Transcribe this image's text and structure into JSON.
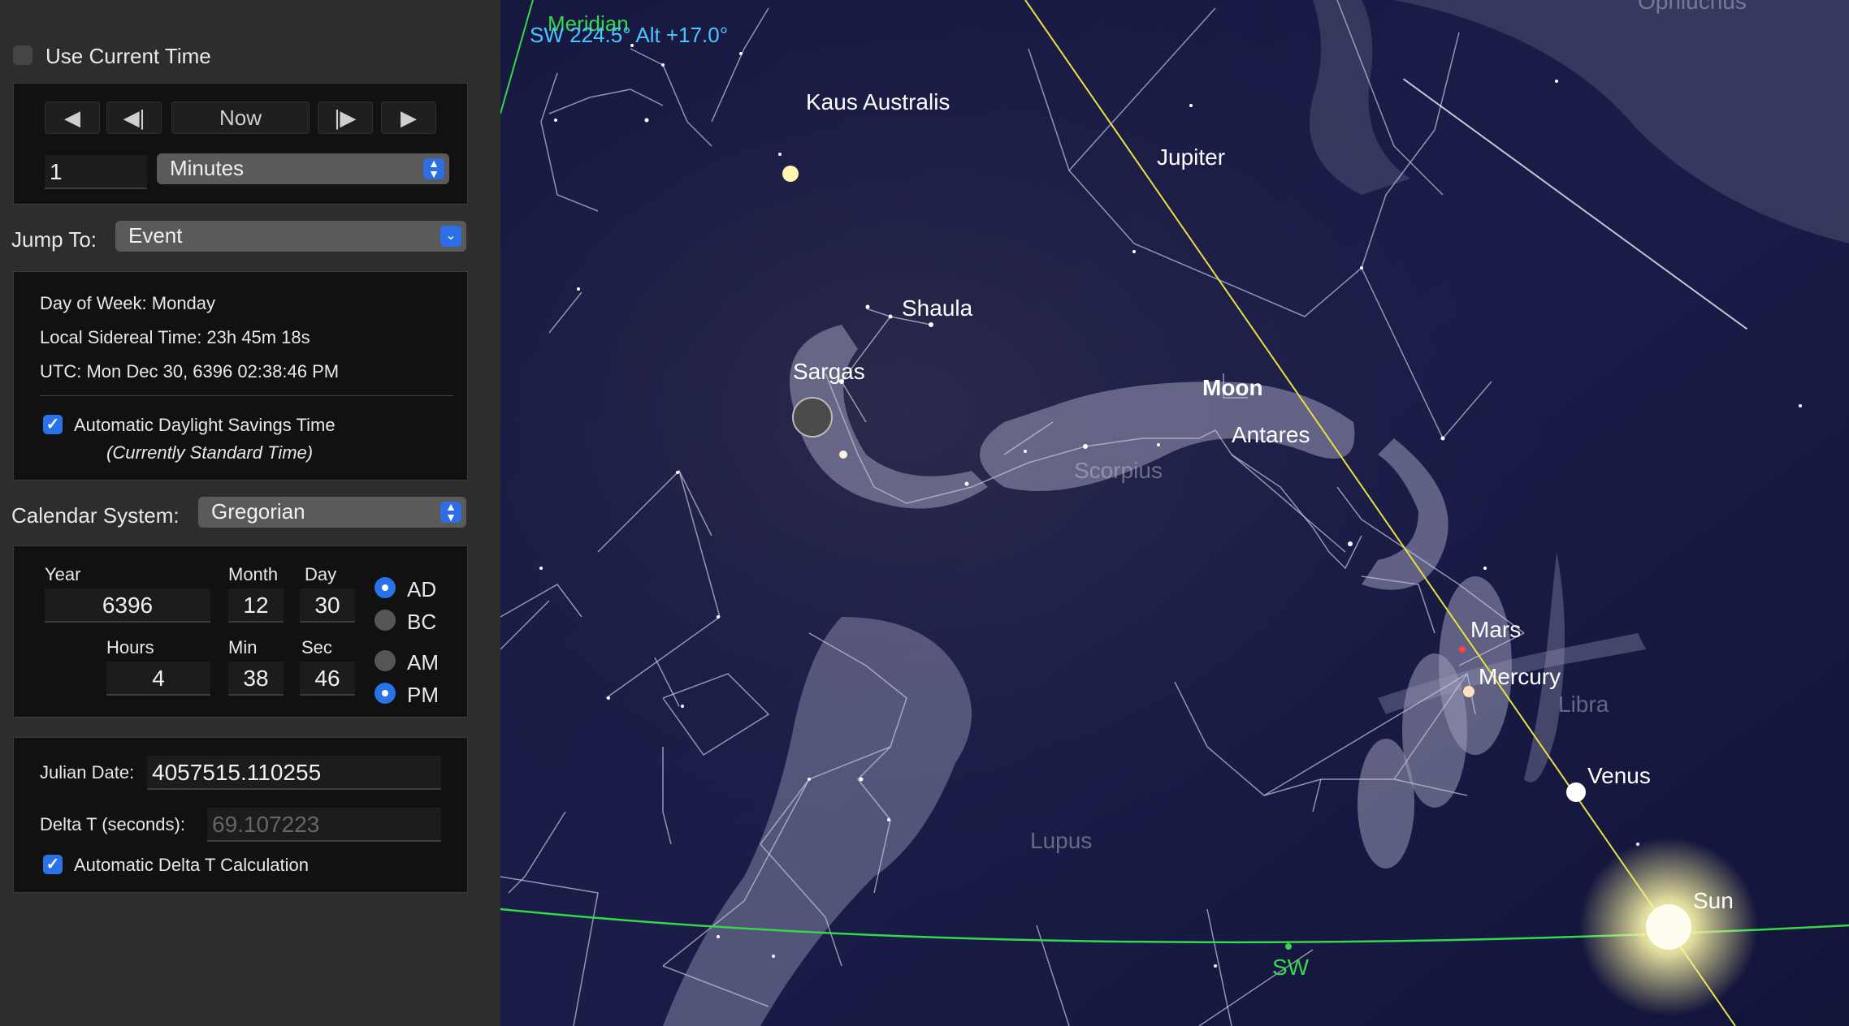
{
  "controls": {
    "use_current_time": "Use Current Time",
    "now_button": "Now",
    "step_value": "1",
    "step_unit": "Minutes",
    "jump_to_label": "Jump To:",
    "jump_to_value": "Event"
  },
  "info": {
    "day_of_week": "Day of Week:  Monday",
    "sidereal": "Local Sidereal Time:  23h 45m 18s",
    "utc": "UTC:  Mon Dec 30, 6396  02:38:46 PM",
    "auto_dst": "Automatic Daylight Savings Time",
    "dst_status": "(Currently Standard Time)"
  },
  "calendar": {
    "label": "Calendar System:",
    "value": "Gregorian",
    "year_label": "Year",
    "month_label": "Month",
    "day_label": "Day",
    "year": "6396",
    "month": "12",
    "day": "30",
    "hours_label": "Hours",
    "min_label": "Min",
    "sec_label": "Sec",
    "hours": "4",
    "min": "38",
    "sec": "46",
    "ad": "AD",
    "bc": "BC",
    "am": "AM",
    "pm": "PM"
  },
  "julian": {
    "julian_label": "Julian Date:",
    "julian_value": "4057515.110255",
    "delta_label": "Delta T (seconds):",
    "delta_value": "69.107223",
    "auto_delta": "Automatic Delta T Calculation"
  },
  "sky": {
    "meridian": "Meridian",
    "direction": "SW 224.5° Alt +17.0°",
    "ophiuchus": "Ophiuchus",
    "kaus_australis": "Kaus Australis",
    "jupiter": "Jupiter",
    "shaula": "Shaula",
    "sargas": "Sargas",
    "moon": "Moon",
    "antares": "Antares",
    "scorpius": "Scorpius",
    "mars": "Mars",
    "mercury": "Mercury",
    "libra": "Libra",
    "venus": "Venus",
    "lupus": "Lupus",
    "sun": "Sun",
    "sw": "SW"
  },
  "colors": {
    "accent": "#2a72e8",
    "horizon": "#34d84a",
    "ecliptic": "#e8e040",
    "sky": "#14163a"
  }
}
